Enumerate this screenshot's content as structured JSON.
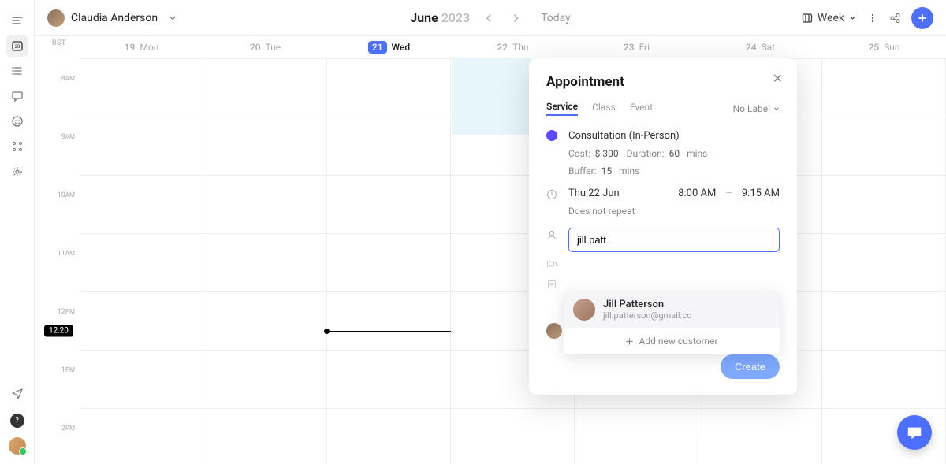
{
  "profile": {
    "name": "Claudia Anderson"
  },
  "header": {
    "month": "June",
    "year": "2023",
    "today_label": "Today",
    "view_label": "Week"
  },
  "timezone": "BST",
  "days": [
    {
      "num": "19",
      "name": "Mon",
      "today": false
    },
    {
      "num": "20",
      "name": "Tue",
      "today": false
    },
    {
      "num": "21",
      "name": "Wed",
      "today": true
    },
    {
      "num": "22",
      "name": "Thu",
      "today": false
    },
    {
      "num": "23",
      "name": "Fri",
      "today": false
    },
    {
      "num": "24",
      "name": "Sat",
      "today": false
    },
    {
      "num": "25",
      "name": "Sun",
      "today": false
    }
  ],
  "hours": [
    "8",
    "9",
    "10",
    "11",
    "12",
    "1",
    "2"
  ],
  "hour_suffix": [
    "AM",
    "AM",
    "AM",
    "AM",
    "PM",
    "PM",
    "PM"
  ],
  "now_time": "12:20",
  "popover": {
    "title": "Appointment",
    "tabs": [
      "Service",
      "Class",
      "Event"
    ],
    "no_label": "No Label",
    "service_name": "Consultation (In-Person)",
    "cost_label": "Cost:",
    "cost_value": "$ 300",
    "duration_label": "Duration:",
    "duration_value": "60",
    "duration_unit": "mins",
    "buffer_label": "Buffer:",
    "buffer_value": "15",
    "buffer_unit": "mins",
    "date_text": "Thu 22 Jun",
    "start_time": "8:00 AM",
    "end_time": "9:15 AM",
    "repeat_text": "Does not repeat",
    "search_value": "jill patt",
    "suggestion_name": "Jill Patterson",
    "suggestion_email": "jill.patterson@gmail.co",
    "add_customer": "Add new customer",
    "staff_name": "Claudia Anderson",
    "create_label": "Create"
  }
}
